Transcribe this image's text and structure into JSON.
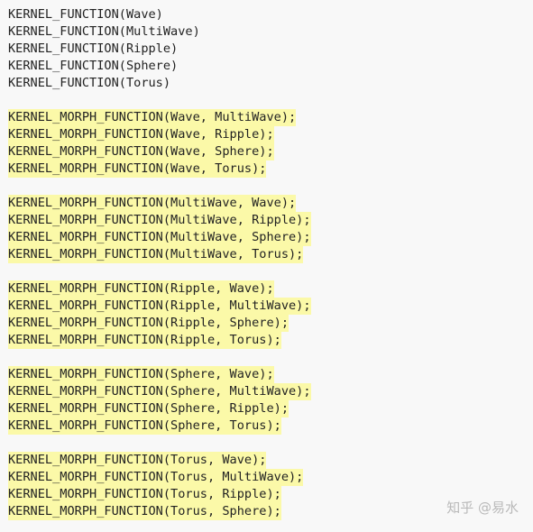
{
  "code": {
    "declarations": [
      "KERNEL_FUNCTION(Wave)",
      "KERNEL_FUNCTION(MultiWave)",
      "KERNEL_FUNCTION(Ripple)",
      "KERNEL_FUNCTION(Sphere)",
      "KERNEL_FUNCTION(Torus)"
    ],
    "morph_groups": [
      [
        "KERNEL_MORPH_FUNCTION(Wave, MultiWave);",
        "KERNEL_MORPH_FUNCTION(Wave, Ripple);",
        "KERNEL_MORPH_FUNCTION(Wave, Sphere);",
        "KERNEL_MORPH_FUNCTION(Wave, Torus);"
      ],
      [
        "KERNEL_MORPH_FUNCTION(MultiWave, Wave);",
        "KERNEL_MORPH_FUNCTION(MultiWave, Ripple);",
        "KERNEL_MORPH_FUNCTION(MultiWave, Sphere);",
        "KERNEL_MORPH_FUNCTION(MultiWave, Torus);"
      ],
      [
        "KERNEL_MORPH_FUNCTION(Ripple, Wave);",
        "KERNEL_MORPH_FUNCTION(Ripple, MultiWave);",
        "KERNEL_MORPH_FUNCTION(Ripple, Sphere);",
        "KERNEL_MORPH_FUNCTION(Ripple, Torus);"
      ],
      [
        "KERNEL_MORPH_FUNCTION(Sphere, Wave);",
        "KERNEL_MORPH_FUNCTION(Sphere, MultiWave);",
        "KERNEL_MORPH_FUNCTION(Sphere, Ripple);",
        "KERNEL_MORPH_FUNCTION(Sphere, Torus);"
      ],
      [
        "KERNEL_MORPH_FUNCTION(Torus, Wave);",
        "KERNEL_MORPH_FUNCTION(Torus, MultiWave);",
        "KERNEL_MORPH_FUNCTION(Torus, Ripple);",
        "KERNEL_MORPH_FUNCTION(Torus, Sphere);"
      ]
    ]
  },
  "watermark": "知乎 @易水",
  "colors": {
    "background": "#f8f8f8",
    "highlight": "#fbf9a8",
    "text": "#222222",
    "watermark": "#b9b9b9"
  }
}
